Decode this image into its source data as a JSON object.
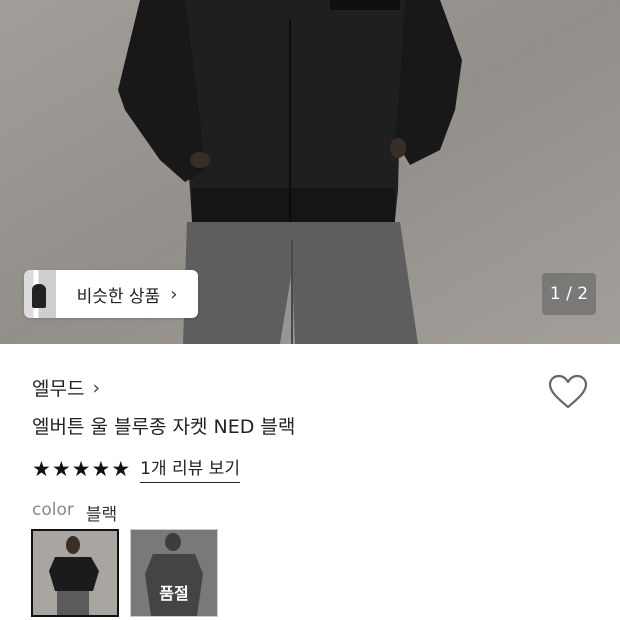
{
  "hero": {
    "similar_button_label": "비슷한 상품",
    "similar_button_chevron": "›",
    "page_counter": "1 / 2"
  },
  "product": {
    "brand": "엘무드",
    "brand_chevron": "›",
    "title": "엘버튼 울 블루종 자켓 NED 블랙",
    "rating_stars": 5,
    "review_link": "1개 리뷰 보기"
  },
  "options": {
    "color_label": "color",
    "color_value": "블랙",
    "swatches": [
      {
        "name": "블랙",
        "selected": true
      },
      {
        "name": "품절",
        "sold_out": true,
        "badge": "품절"
      }
    ]
  },
  "icons": {
    "heart": "heart-outline-icon",
    "star": "star-filled-icon",
    "chevron": "chevron-right-icon"
  }
}
